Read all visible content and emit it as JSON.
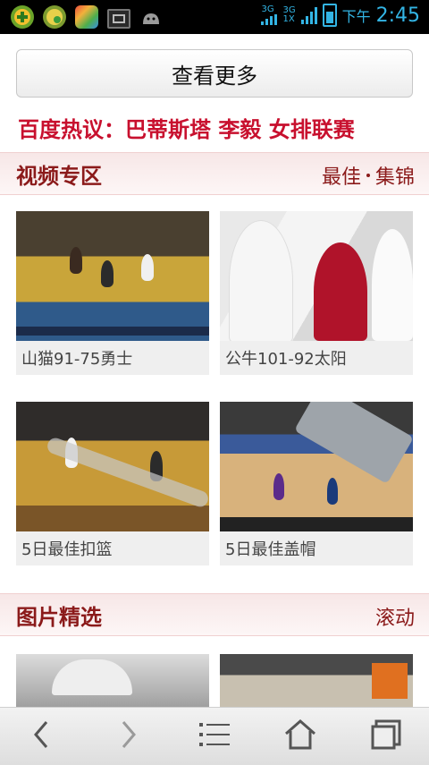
{
  "status_bar": {
    "network_top": "3G",
    "network_stack_top": "3G",
    "network_stack_bottom": "1X",
    "ampm": "下午",
    "time": "2:45"
  },
  "more_button": {
    "label": "查看更多"
  },
  "hot_topics": {
    "prefix": "百度热议：",
    "items": [
      "巴蒂斯塔",
      "李毅",
      "女排联赛"
    ]
  },
  "video_section": {
    "title": "视频专区",
    "right_links": [
      "最佳",
      "集锦"
    ],
    "cards": [
      {
        "caption": "山猫91-75勇士"
      },
      {
        "caption": "公牛101-92太阳"
      },
      {
        "caption": "5日最佳扣篮"
      },
      {
        "caption": "5日最佳盖帽"
      }
    ]
  },
  "picture_section": {
    "title": "图片精选",
    "right_link": "滚动"
  },
  "bottom_nav": {
    "icons": [
      "back-icon",
      "forward-icon",
      "menu-icon",
      "home-icon",
      "tabs-icon"
    ]
  },
  "colors": {
    "accent_red": "#c8102e",
    "section_text": "#8b1a1a",
    "status_blue": "#33b5e5"
  }
}
